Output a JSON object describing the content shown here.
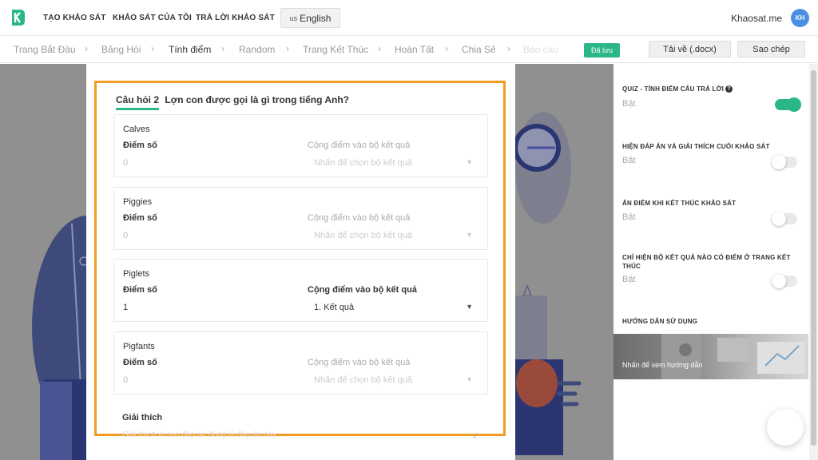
{
  "nav": {
    "items": [
      "TẠO KHẢO SÁT",
      "KHẢO SÁT CỦA TÔI",
      "TRẢ LỜI KHẢO SÁT"
    ],
    "language_flag": "us",
    "language": "English",
    "brand_name": "Khaosat.me",
    "avatar_initials": "KH"
  },
  "steps": {
    "items": [
      "Trang Bắt Đầu",
      "Bảng Hỏi",
      "Tính điểm",
      "Random",
      "Trang Kết Thúc",
      "Hoàn Tất",
      "Chia Sẻ",
      "Báo cáo"
    ],
    "separator": "›",
    "saved_badge": "Đã lưu",
    "download_label": "Tải về (.docx)",
    "copy_label": "Sao chép"
  },
  "question": {
    "tag": "Câu hỏi 2",
    "text": "Lợn con được gọi là gì trong tiếng Anh?",
    "points_label": "Điểm số",
    "result_label": "Cộng điểm vào bộ kết quả",
    "answers": [
      {
        "name": "Calves",
        "points": "0",
        "result": "Nhấn để chọn bộ kết quả"
      },
      {
        "name": "Piggies",
        "points": "0",
        "result": "Nhấn để chọn bộ kết quả"
      },
      {
        "name": "Piglets",
        "points": "1",
        "result": "1. Kết quả"
      },
      {
        "name": "Pigfants",
        "points": "0",
        "result": "Nhấn để chọn bộ kết quả"
      }
    ],
    "caret": "▼",
    "explanation_label": "Giải thích",
    "explanation_placeholder": "Giải thích vì sao đáp án đúng là đáp án này..."
  },
  "settings": {
    "quiz_title": "QUIZ - TÍNH ĐIỂM CÂU TRẢ LỜI",
    "quiz_value": "Bật",
    "help_glyph": "?",
    "show_answers_title": "HIỆN ĐÁP ÁN VÀ GIẢI THÍCH CUỐI KHẢO SÁT",
    "show_answers_value": "Bật",
    "hide_score_title": "ẨN ĐIỂM KHI KẾT THÚC KHẢO SÁT",
    "hide_score_value": "Bật",
    "only_scored_title": "CHỈ HIỆN BỘ KẾT QUẢ NÀO CÓ ĐIỂM Ở TRANG KẾT THÚC",
    "only_scored_value": "Bật",
    "guide_title": "HƯỚNG DẪN SỬ DỤNG",
    "guide_cta": "Nhấn để xem hướng dẫn"
  },
  "colors": {
    "accent": "#2bb68a",
    "highlight": "#f39c22",
    "avatar": "#4a90e2"
  }
}
